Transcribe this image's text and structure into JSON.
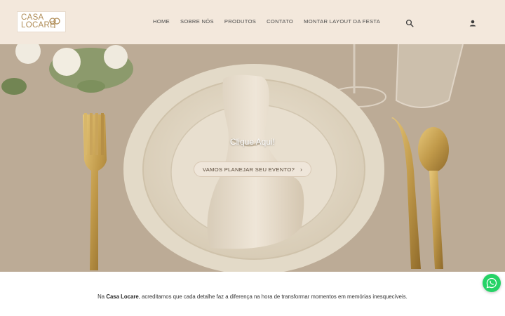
{
  "brand": {
    "logo_line1": "CASA",
    "logo_line2": "LOCARE",
    "logo_color": "#b08d57"
  },
  "nav": {
    "items": [
      {
        "label": "HOME"
      },
      {
        "label": "SOBRE NÓS"
      },
      {
        "label": "PRODUTOS"
      },
      {
        "label": "CONTATO"
      },
      {
        "label": "MONTAR LAYOUT DA FESTA"
      }
    ]
  },
  "header_icons": {
    "search": "search-icon",
    "account": "user-icon"
  },
  "hero": {
    "title": "Clique Aqui!",
    "button_label": "VAMOS PLANEJAR SEU EVENTO?",
    "button_chevron": "›"
  },
  "intro": {
    "prefix": "Na ",
    "brand": "Casa Locare",
    "suffix": ", acreditamos que cada detalhe faz a diferença na hora de transformar momentos em memórias inesquecíveis."
  },
  "floating": {
    "whatsapp": "whatsapp-icon",
    "color": "#25d366"
  },
  "colors": {
    "header_bg": "#f3e8dc",
    "accent_gold": "#b08d57"
  }
}
